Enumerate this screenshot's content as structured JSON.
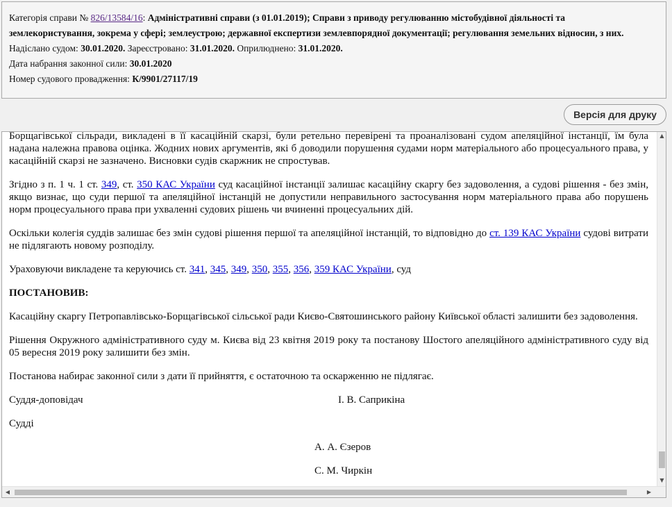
{
  "case_info": {
    "category_label": "Категорія справи №",
    "case_number": "826/13584/16",
    "category_line1": "Адміністративні справи (з 01.01.2019); Справи з приводу регулюванню містобудівної діяльності та",
    "category_line2": "землекористування, зокрема у сфері; землеустрою; державної експертизи землевпорядної документації; регулювання земельних відносин, з них.",
    "sent_label": "Надіслано судом:",
    "sent_date": "30.01.2020.",
    "registered_label": "Зареєстровано:",
    "registered_date": "31.01.2020.",
    "published_label": "Оприлюднено:",
    "published_date": "31.01.2020.",
    "effective_label": "Дата набрання законної сили:",
    "effective_date": "30.01.2020",
    "proceeding_label": "Номер судового провадження:",
    "proceeding_number": "К/9901/27117/19"
  },
  "toolbar": {
    "print_label": "Версія для друку"
  },
  "document": {
    "p1": "Борщагівської сільради, викладені в її касаційній скарзі, були ретельно перевірені та проаналізовані судом апеляційної інстанції, їм була надана належна правова оцінка. Жодних нових аргументів, які б доводили порушення судами норм матеріального або процесуального права, у касаційній скарзі не зазначено. Висновки судів скаржник не спростував.",
    "p2_a": "Згідно з п. 1 ч. 1 ст.",
    "p2_link1": "349",
    "p2_b": ", ст.",
    "p2_link2": "350 КАС України",
    "p2_c": "суд касаційної інстанції залишає касаційну скаргу без задоволення, а судові рішення - без змін, якщо визнає, що суди першої та апеляційної інстанцій не допустили неправильного застосування норм матеріального права або порушень норм процесуального права при ухваленні судових рішень чи вчиненні процесуальних дій.",
    "p3_a": "Оскільки колегія суддів залишає без змін судові рішення першої та апеляційної інстанцій, то відповідно до",
    "p3_link": "ст. 139 КАС України",
    "p3_b": "судові витрати не підлягають новому розподілу.",
    "p4_a": "Ураховуючи викладене та керуючись ст.",
    "p4_links": [
      "341",
      "345",
      "349",
      "350",
      "355",
      "356",
      "359 КАС  України"
    ],
    "p4_b": ", суд",
    "heading": "ПОСТАНОВИВ:",
    "p5": "Касаційну скаргу Петропавлівсько-Борщагівської сільської ради Києво-Святошинського району Київської області залишити без задоволення.",
    "p6": "Рішення Окружного адміністративного суду м. Києва від 23 квітня 2019 року та постанову Шостого апеляційного адміністративного суду від 05 вересня 2019 року залишити без змін.",
    "p7": "Постанова набирає законної сили з дати її прийняття, є остаточною та оскарженню не підлягає.",
    "reporter_label": "Суддя-доповідач",
    "reporter_name": "І. В. Саприкіна",
    "judges_label": "Судді",
    "judge1": "А. А. Єзеров",
    "judge2": "С. М. Чиркін"
  },
  "icons": {
    "scroll_up": "▲",
    "scroll_down": "▼",
    "scroll_left": "◀",
    "scroll_right": "▶"
  }
}
